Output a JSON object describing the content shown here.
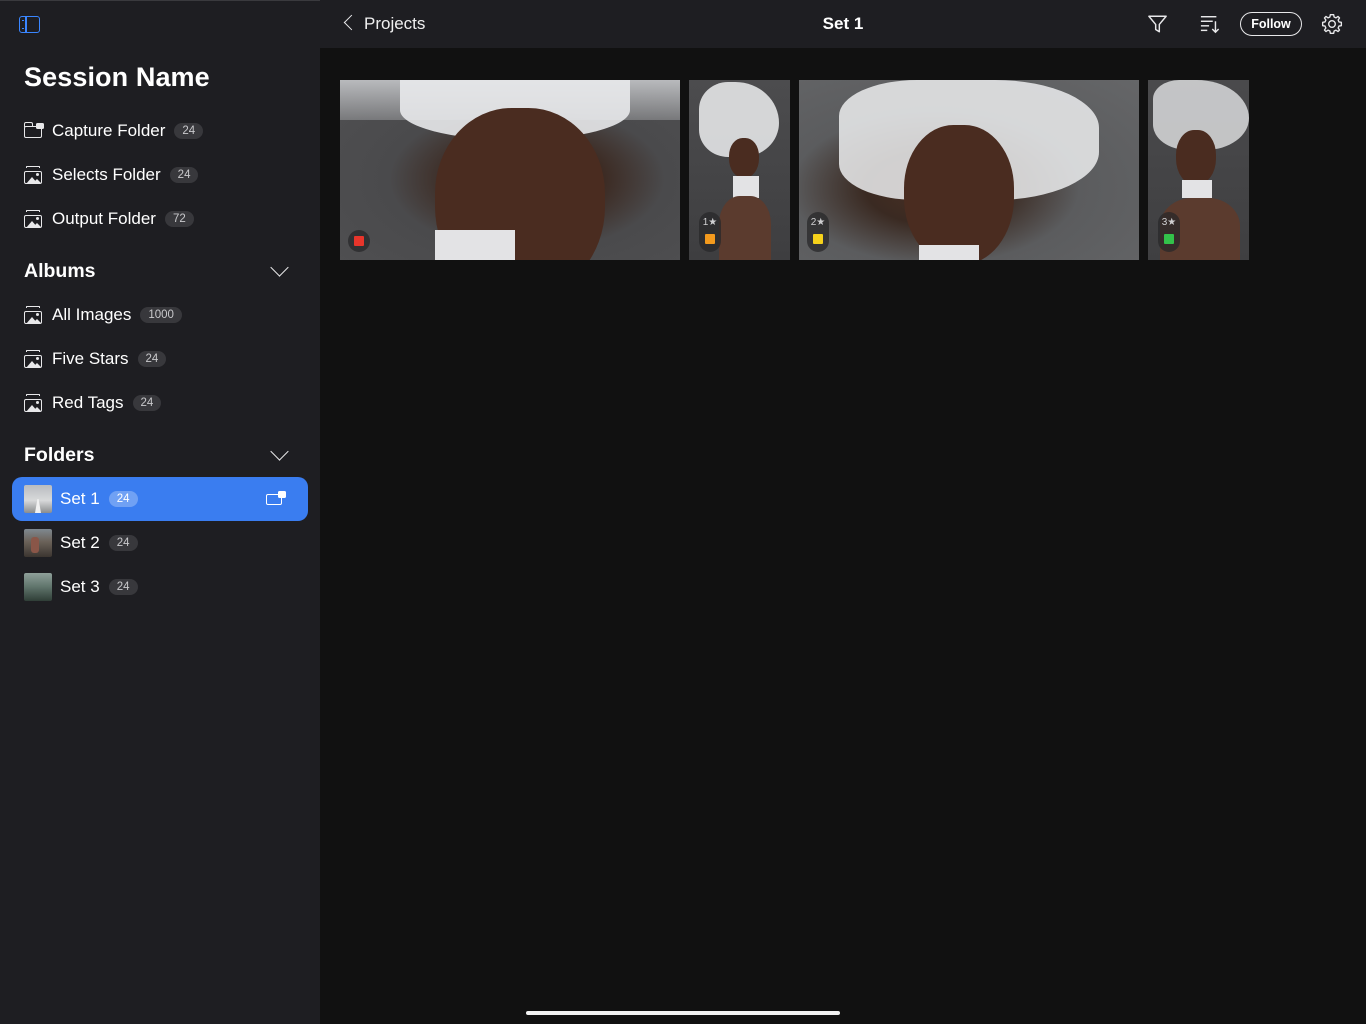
{
  "sidebar": {
    "session_name": "Session Name",
    "session_items": [
      {
        "label": "Capture Folder",
        "count": "24",
        "icon": "capture-folder-icon"
      },
      {
        "label": "Selects Folder",
        "count": "24",
        "icon": "album-icon"
      },
      {
        "label": "Output Folder",
        "count": "72",
        "icon": "album-icon"
      }
    ],
    "albums_title": "Albums",
    "albums": [
      {
        "label": "All Images",
        "count": "1000",
        "icon": "album-icon"
      },
      {
        "label": "Five Stars",
        "count": "24",
        "icon": "album-icon"
      },
      {
        "label": "Red Tags",
        "count": "24",
        "icon": "album-icon"
      }
    ],
    "folders_title": "Folders",
    "folders": [
      {
        "label": "Set 1",
        "count": "24",
        "selected": true
      },
      {
        "label": "Set 2",
        "count": "24",
        "selected": false
      },
      {
        "label": "Set 3",
        "count": "24",
        "selected": false
      }
    ]
  },
  "topbar": {
    "back_label": "Projects",
    "title": "Set 1",
    "follow_label": "Follow"
  },
  "photos": [
    {
      "stars": "",
      "color_tag": "#e8352b"
    },
    {
      "stars": "1★",
      "color_tag": "#f39a1d"
    },
    {
      "stars": "2★",
      "color_tag": "#f6d21b"
    },
    {
      "stars": "3★",
      "color_tag": "#33c24a"
    }
  ],
  "colors": {
    "accent": "#3a7df0",
    "sidebar_bg": "#1e1e22",
    "content_bg": "#111111"
  }
}
